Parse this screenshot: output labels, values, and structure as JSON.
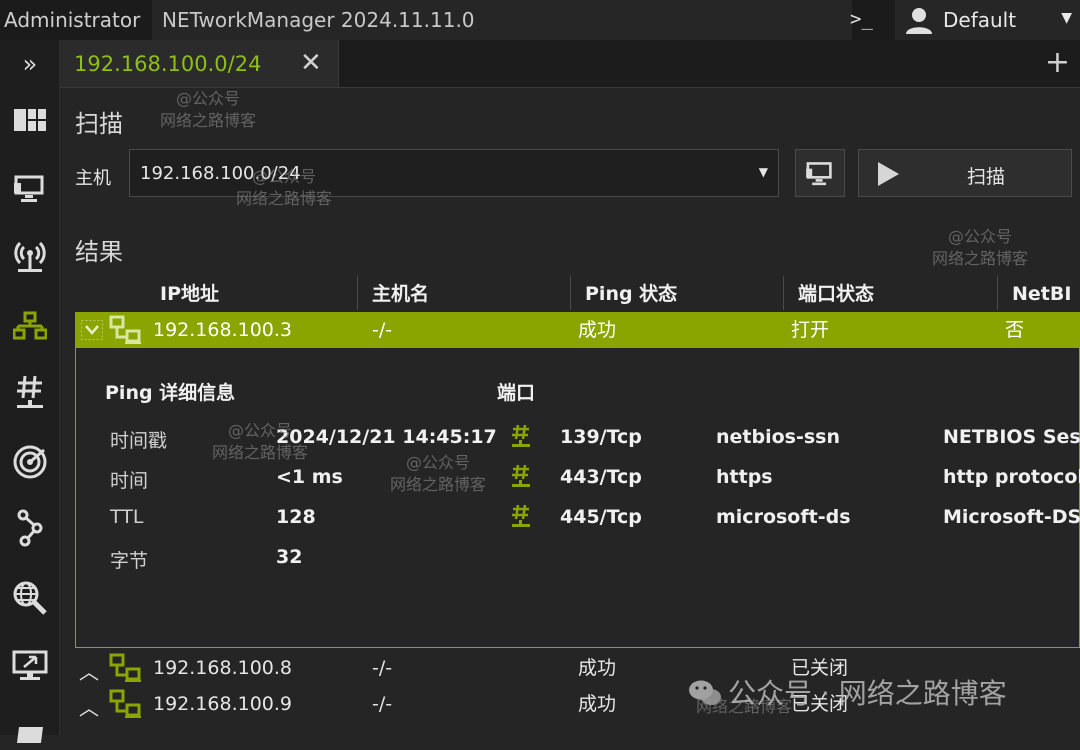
{
  "titlebar": {
    "user": "Administrator",
    "app_title": "NETworkManager 2024.11.11.0",
    "terminal_icon": "terminal-icon",
    "profile_name": "Default"
  },
  "sidebar": {
    "expand_glyph": "»",
    "items": [
      {
        "icon": "dashboard-icon"
      },
      {
        "icon": "network-interface-icon"
      },
      {
        "icon": "wifi-icon"
      },
      {
        "icon": "ip-scanner-icon",
        "active": true
      },
      {
        "icon": "port-scanner-icon"
      },
      {
        "icon": "ping-monitor-icon"
      },
      {
        "icon": "traceroute-icon"
      },
      {
        "icon": "dns-lookup-icon"
      },
      {
        "icon": "remote-desktop-icon"
      },
      {
        "icon": "powershell-icon"
      }
    ]
  },
  "tab": {
    "label": "192.168.100.0/24",
    "close_glyph": "✕",
    "add_glyph": "+"
  },
  "scan": {
    "title": "扫描",
    "host_label": "主机",
    "host_value": "192.168.100.0/24",
    "button_label": "扫描"
  },
  "results": {
    "title": "结果",
    "columns": [
      "IP地址",
      "主机名",
      "Ping 状态",
      "端口状态",
      "NetBI"
    ],
    "selected_row": {
      "ip": "192.168.100.3",
      "hostname": "-/-",
      "ping_status": "成功",
      "port_status": "打开",
      "netbios": "否"
    },
    "details": {
      "ping_title": "Ping 详细信息",
      "ports_title": "端口",
      "ping_fields": [
        {
          "label": "时间戳",
          "value": "2024/12/21 14:45:17"
        },
        {
          "label": "时间",
          "value": "<1 ms"
        },
        {
          "label": "TTL",
          "value": "128"
        },
        {
          "label": "字节",
          "value": "32"
        }
      ],
      "ports": [
        {
          "port": "139/Tcp",
          "protocol": "netbios-ssn",
          "description": "NETBIOS Session Service"
        },
        {
          "port": "443/Tcp",
          "protocol": "https",
          "description": "http protocol over TLS/SSL"
        },
        {
          "port": "445/Tcp",
          "protocol": "microsoft-ds",
          "description": "Microsoft-DS"
        }
      ]
    },
    "rows": [
      {
        "ip": "192.168.100.8",
        "hostname": "-/-",
        "ping_status": "成功",
        "port_status": "已关闭"
      },
      {
        "ip": "192.168.100.9",
        "hostname": "-/-",
        "ping_status": "成功",
        "port_status": "已关闭"
      }
    ]
  },
  "watermarks": {
    "small_line1": "@公众号",
    "small_line2": "网络之路博客",
    "brand": "公众号 · 网络之路博客"
  },
  "colors": {
    "accent": "#8aa400",
    "accent_text": "#8fbf12",
    "background": "#252526"
  }
}
